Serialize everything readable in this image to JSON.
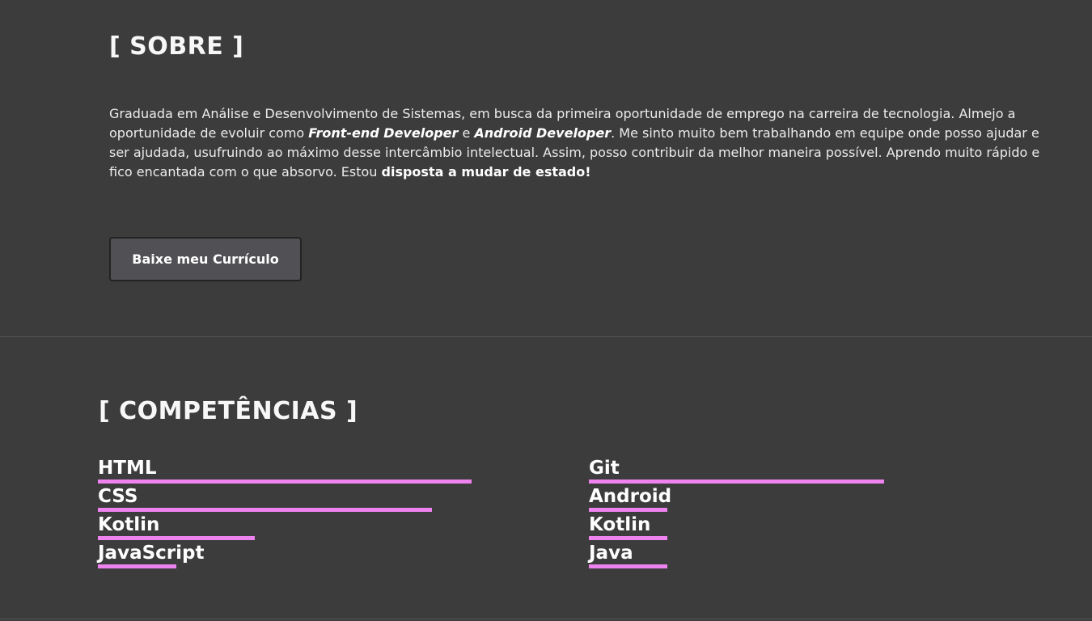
{
  "sobre": {
    "title": "[ SOBRE ]",
    "text_1": "Graduada em Análise e Desenvolvimento de Sistemas, em busca da primeira oportunidade de emprego na carreira de tecnologia. Almejo a oportunidade de evoluir como ",
    "emphasis_1": "Front-end Developer",
    "text_2": " e ",
    "emphasis_2": "Android Developer",
    "text_3": ". Me sinto muito bem trabalhando em equipe onde posso ajudar e ser ajudada, usufruindo ao máximo desse intercâmbio intelectual. Assim, posso contribuir da melhor maneira possível. Aprendo muito rápido e fico encantada com o que absorvo. Estou ",
    "strong_1": "disposta a mudar de estado!",
    "button_label": "Baixe meu Currículo"
  },
  "competencias": {
    "title": "[ COMPETÊNCIAS ]",
    "bar_color": "#ee82ee",
    "left": [
      {
        "name": "HTML",
        "level": 0.95
      },
      {
        "name": "CSS",
        "level": 0.85
      },
      {
        "name": "Kotlin",
        "level": 0.4
      },
      {
        "name": "JavaScript",
        "level": 0.2
      }
    ],
    "right": [
      {
        "name": "Git",
        "level": 0.75
      },
      {
        "name": "Android",
        "level": 0.2
      },
      {
        "name": "Kotlin",
        "level": 0.2
      },
      {
        "name": "Java",
        "level": 0.2
      }
    ]
  }
}
